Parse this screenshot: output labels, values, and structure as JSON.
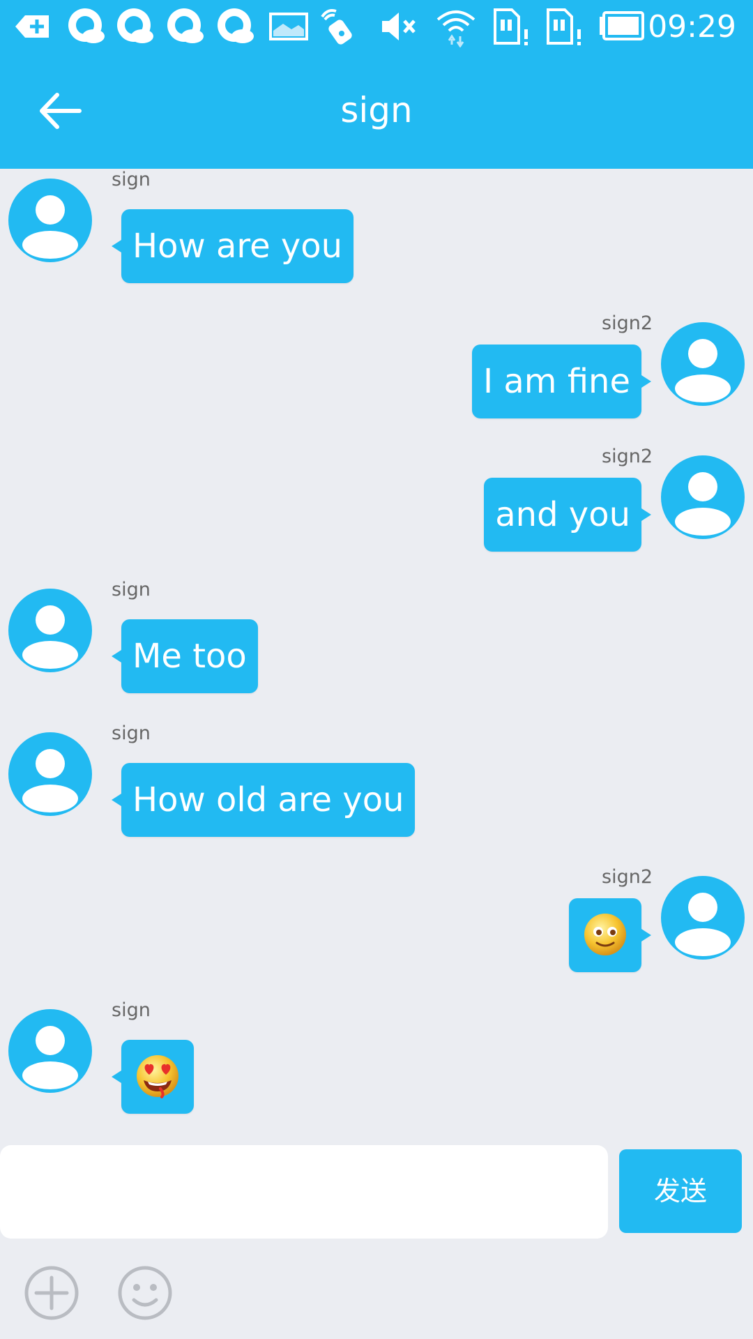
{
  "status_bar": {
    "time": "09:29",
    "icons": [
      "notification-plus-icon",
      "cloud-icon",
      "cloud-icon",
      "cloud-icon",
      "cloud-icon",
      "image-icon",
      "nfc-icon",
      "mute-icon",
      "wifi-icon",
      "sim-alert-icon",
      "sim-alert-icon",
      "battery-icon"
    ]
  },
  "header": {
    "title": "sign",
    "back_icon": "arrow-left-icon"
  },
  "messages": [
    {
      "side": "left",
      "sender": "sign",
      "text": "How are you"
    },
    {
      "side": "right",
      "sender": "sign2",
      "text": "I am fine"
    },
    {
      "side": "right",
      "sender": "sign2",
      "text": "and you"
    },
    {
      "side": "left",
      "sender": "sign",
      "text": "Me too"
    },
    {
      "side": "left",
      "sender": "sign",
      "text": "How old are you"
    },
    {
      "side": "right",
      "sender": "sign2",
      "emoji": "smiling-emoji"
    },
    {
      "side": "left",
      "sender": "sign",
      "emoji": "heart-eyes-emoji"
    }
  ],
  "composer": {
    "input_value": "",
    "send_label": "发送",
    "tools": [
      "add-circle-icon",
      "smiley-icon"
    ]
  },
  "colors": {
    "accent": "#22baf2",
    "background": "#ebedf2",
    "bubble_text": "#ffffff",
    "sender_text": "#666666"
  }
}
